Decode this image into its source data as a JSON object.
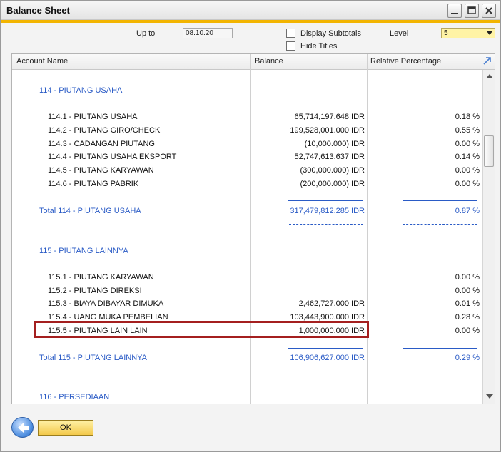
{
  "window": {
    "title": "Balance Sheet"
  },
  "filters": {
    "up_to_label": "Up to",
    "up_to_value": "08.10.20",
    "display_subtotals_label": "Display Subtotals",
    "hide_titles_label": "Hide Titles",
    "level_label": "Level",
    "level_value": "5"
  },
  "grid": {
    "headers": {
      "account": "Account Name",
      "balance": "Balance",
      "pct": "Relative Percentage"
    },
    "rows": [
      {
        "name": "114 - PIUTANG USAHA",
        "balance": "",
        "pct": ""
      },
      {
        "name": "114.1 - PIUTANG USAHA",
        "balance": "65,714,197.648  IDR",
        "pct": "0.18 %"
      },
      {
        "name": "114.2 - PIUTANG GIRO/CHECK",
        "balance": "199,528,001.000  IDR",
        "pct": "0.55 %"
      },
      {
        "name": "114.3 - CADANGAN PIUTANG",
        "balance": "(10,000.000)  IDR",
        "pct": "0.00 %"
      },
      {
        "name": "114.4 - PIUTANG USAHA EKSPORT",
        "balance": "52,747,613.637  IDR",
        "pct": "0.14 %"
      },
      {
        "name": "114.5 - PIUTANG KARYAWAN",
        "balance": "(300,000.000)  IDR",
        "pct": "0.00 %"
      },
      {
        "name": "114.6 - PIUTANG PABRIK",
        "balance": "(200,000.000)  IDR",
        "pct": "0.00 %"
      },
      {
        "name": "Total 114 - PIUTANG USAHA",
        "balance": "317,479,812.285  IDR",
        "pct": "0.87 %"
      },
      {
        "name": "115 - PIUTANG LAINNYA",
        "balance": "",
        "pct": ""
      },
      {
        "name": "115.1 - PIUTANG KARYAWAN",
        "balance": "",
        "pct": "0.00 %"
      },
      {
        "name": "115.2 - PIUTANG DIREKSI",
        "balance": "",
        "pct": "0.00 %"
      },
      {
        "name": "115.3 - BIAYA DIBAYAR DIMUKA",
        "balance": "2,462,727.000  IDR",
        "pct": "0.01 %"
      },
      {
        "name": "115.4 - UANG MUKA PEMBELIAN",
        "balance": "103,443,900.000  IDR",
        "pct": "0.28 %"
      },
      {
        "name": "115.5 - PIUTANG LAIN LAIN",
        "balance": "1,000,000.000  IDR",
        "pct": "0.00 %"
      },
      {
        "name": "Total 115 - PIUTANG LAINNYA",
        "balance": "106,906,627.000  IDR",
        "pct": "0.29 %"
      },
      {
        "name": "116 - PERSEDIAAN",
        "balance": "",
        "pct": ""
      }
    ]
  },
  "footer": {
    "ok_label": "OK"
  },
  "colors": {
    "accent": "#f2b400",
    "link_blue": "#2a5bc6",
    "highlight_red": "#a41f1f",
    "level_field": "#fff3a6"
  },
  "icons": [
    "minimize-icon",
    "maximize-icon",
    "close-icon",
    "checkbox-icon",
    "dropdown-arrow-icon",
    "expand-icon",
    "back-arrow-icon"
  ]
}
